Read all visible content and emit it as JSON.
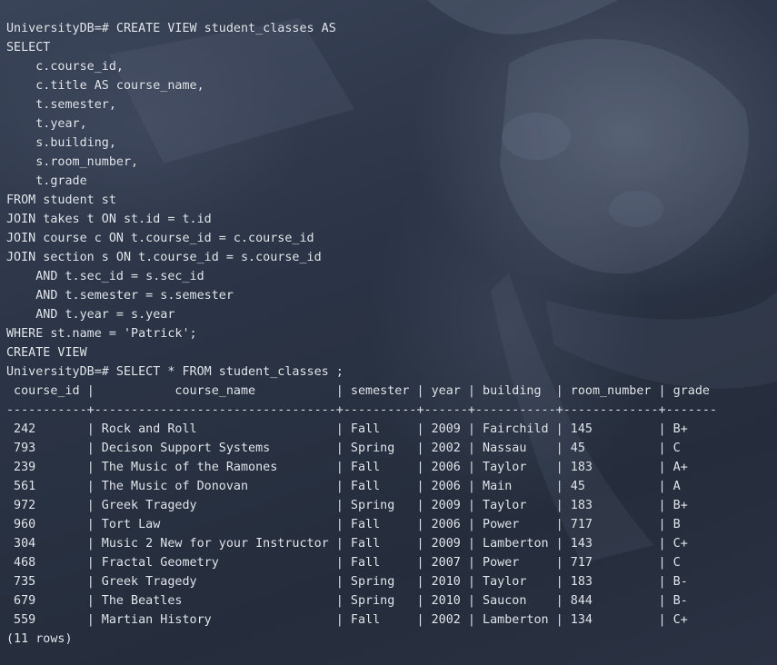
{
  "terminal": {
    "prompt": "UniversityDB=#",
    "create_view_command": "CREATE VIEW student_classes AS",
    "sql_lines": [
      "SELECT",
      "    c.course_id,",
      "    c.title AS course_name,",
      "    t.semester,",
      "    t.year,",
      "    s.building,",
      "    s.room_number,",
      "    t.grade",
      "FROM student st",
      "JOIN takes t ON st.id = t.id",
      "JOIN course c ON t.course_id = c.course_id",
      "JOIN section s ON t.course_id = s.course_id",
      "    AND t.sec_id = s.sec_id",
      "    AND t.semester = s.semester",
      "    AND t.year = s.year",
      "WHERE st.name = 'Patrick';"
    ],
    "create_view_result": "CREATE VIEW",
    "select_command": "SELECT * FROM student_classes ;",
    "result_columns": [
      "course_id",
      "course_name",
      "semester",
      "year",
      "building",
      "room_number",
      "grade"
    ],
    "result_rows": [
      [
        "242",
        "Rock and Roll",
        "Fall",
        "2009",
        "Fairchild",
        "145",
        "B+"
      ],
      [
        "793",
        "Decison Support Systems",
        "Spring",
        "2002",
        "Nassau",
        "45",
        "C"
      ],
      [
        "239",
        "The Music of the Ramones",
        "Fall",
        "2006",
        "Taylor",
        "183",
        "A+"
      ],
      [
        "561",
        "The Music of Donovan",
        "Fall",
        "2006",
        "Main",
        "45",
        "A"
      ],
      [
        "972",
        "Greek Tragedy",
        "Spring",
        "2009",
        "Taylor",
        "183",
        "B+"
      ],
      [
        "960",
        "Tort Law",
        "Fall",
        "2006",
        "Power",
        "717",
        "B"
      ],
      [
        "304",
        "Music 2 New for your Instructor",
        "Fall",
        "2009",
        "Lamberton",
        "143",
        "C+"
      ],
      [
        "468",
        "Fractal Geometry",
        "Fall",
        "2007",
        "Power",
        "717",
        "C"
      ],
      [
        "735",
        "Greek Tragedy",
        "Spring",
        "2010",
        "Taylor",
        "183",
        "B-"
      ],
      [
        "679",
        "The Beatles",
        "Spring",
        "2010",
        "Saucon",
        "844",
        "B-"
      ],
      [
        "559",
        "Martian History",
        "Fall",
        "2002",
        "Lamberton",
        "134",
        "C+"
      ]
    ],
    "row_count": "(11 rows)"
  },
  "colors": {
    "background": "#283142",
    "text": "#e3e8ef"
  }
}
